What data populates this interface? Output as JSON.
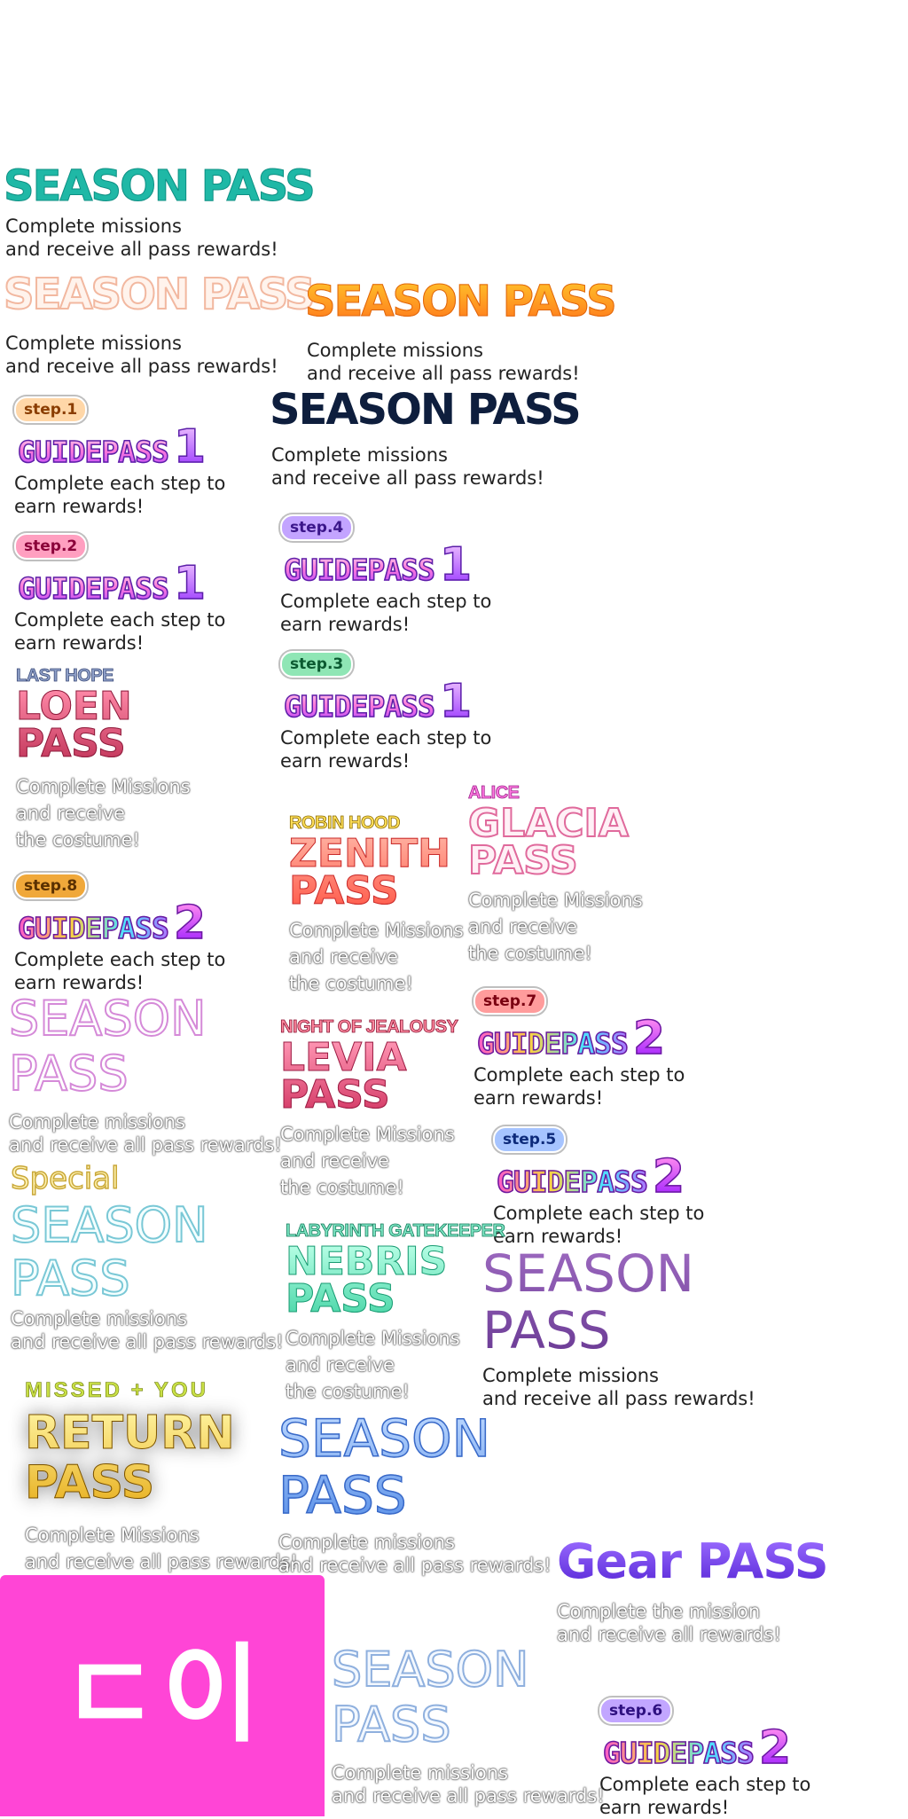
{
  "season_teal": {
    "title": "SEASON PASS",
    "desc": "Complete missions\nand receive all pass rewards!"
  },
  "season_peach": {
    "title": "SEASON PASS",
    "desc": "Complete missions\nand receive all pass rewards!"
  },
  "season_orange": {
    "title": "SEASON PASS",
    "desc": "Complete missions\nand receive all pass rewards!"
  },
  "season_navy": {
    "title": "SEASON PASS",
    "desc": "Complete missions\nand receive all pass rewards!"
  },
  "guide_step1": {
    "badge": "step.1",
    "word": "GUIDEPASS",
    "num": "1",
    "desc": "Complete each step to\nearn rewards!"
  },
  "guide_step2": {
    "badge": "step.2",
    "word": "GUIDEPASS",
    "num": "1",
    "desc": "Complete each step to\nearn rewards!"
  },
  "guide_step4": {
    "badge": "step.4",
    "word": "GUIDEPASS",
    "num": "1",
    "desc": "Complete each step to\nearn rewards!"
  },
  "guide_step3": {
    "badge": "step.3",
    "word": "GUIDEPASS",
    "num": "1",
    "desc": "Complete each step to\nearn rewards!"
  },
  "guide_step8": {
    "badge": "step.8",
    "word": "GUIDEPASS",
    "num": "2",
    "desc": "Complete each step to\nearn rewards!"
  },
  "guide_step7": {
    "badge": "step.7",
    "word": "GUIDEPASS",
    "num": "2",
    "desc": "Complete each step to\nearn rewards!"
  },
  "guide_step5": {
    "badge": "step.5",
    "word": "GUIDEPASS",
    "num": "2",
    "desc": "Complete each step to\nearn rewards!"
  },
  "guide_step6": {
    "badge": "step.6",
    "word": "GUIDEPASS",
    "num": "2",
    "desc": "Complete each step to\nearn rewards!"
  },
  "loen": {
    "head": "LAST HOPE",
    "title": "LOEN\nPASS",
    "desc": "Complete Missions\nand receive\nthe costume!"
  },
  "glacia": {
    "head": "ALICE",
    "title": "GLACIA\nPASS",
    "desc": "Complete Missions\nand receive\nthe costume!"
  },
  "zenith": {
    "head": "ROBIN HOOD",
    "title": "ZENITH\nPASS",
    "desc": "Complete Missions\nand receive\nthe costume!"
  },
  "levia": {
    "head": "NIGHT OF JEALOUSY",
    "title": "LEVIA\nPASS",
    "desc": "Complete Missions\nand receive\nthe costume!"
  },
  "nebris": {
    "head": "LABYRINTH GATEKEEPER",
    "title": "NEBRIS\nPASS",
    "desc": "Complete Missions\nand receive\nthe costume!"
  },
  "season_pink_outline": {
    "title": "SEASON\nPASS",
    "desc": "Complete missions\nand receive all pass rewards!"
  },
  "special_season": {
    "head": "Special",
    "title": "SEASON\nPASS",
    "desc": "Complete missions\nand receive all pass rewards!"
  },
  "season_purple": {
    "title": "SEASON\nPASS",
    "desc": "Complete missions\nand receive all pass rewards!"
  },
  "return_pass": {
    "head": "MISSED + YOU",
    "title": "RETURN\nPASS",
    "desc": "Complete Missions\nand receive all pass rewards!"
  },
  "season_blue": {
    "title": "SEASON\nPASS",
    "desc": "Complete missions\nand receive all pass rewards!"
  },
  "season_light_blue": {
    "title": "SEASON\nPASS",
    "desc": "Complete missions\nand receive all pass rewards!"
  },
  "gear_pass": {
    "title": "Gear PASS",
    "desc": "Complete the mission\nand receive all rewards!"
  },
  "logo_panel": {
    "text": "ㄷ이",
    "color": "#ff45d6"
  }
}
